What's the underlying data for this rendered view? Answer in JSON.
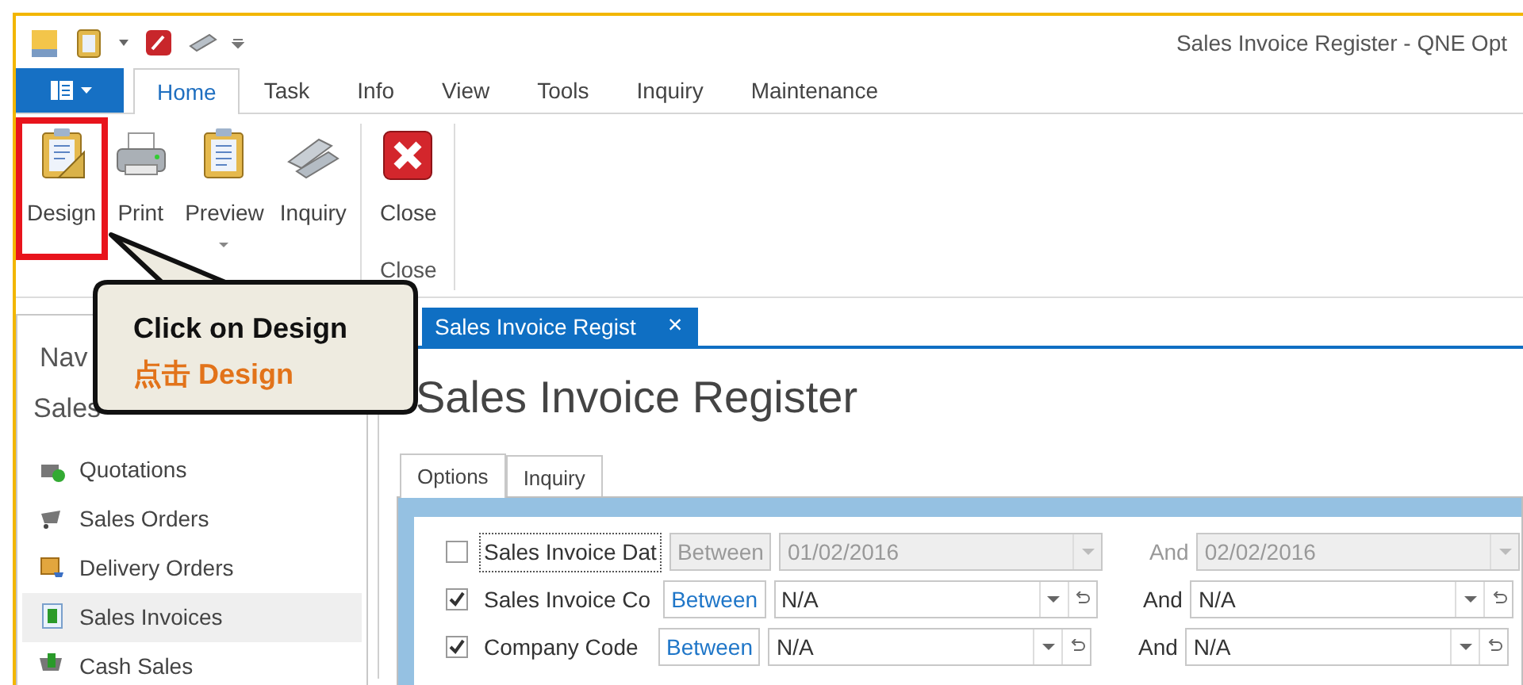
{
  "window": {
    "title": "Sales Invoice Register - QNE Opt"
  },
  "ribbon": {
    "tabs": [
      {
        "label": "Home",
        "selected": true
      },
      {
        "label": "Task",
        "selected": false
      },
      {
        "label": "Info",
        "selected": false
      },
      {
        "label": "View",
        "selected": false
      },
      {
        "label": "Tools",
        "selected": false
      },
      {
        "label": "Inquiry",
        "selected": false
      },
      {
        "label": "Maintenance",
        "selected": false
      }
    ],
    "groups": [
      {
        "buttons": [
          {
            "label": "Design",
            "highlighted": true,
            "dropdown": false
          },
          {
            "label": "Print",
            "highlighted": false,
            "dropdown": false
          },
          {
            "label": "Preview",
            "highlighted": false,
            "dropdown": true
          },
          {
            "label": "Inquiry",
            "highlighted": false,
            "dropdown": false
          }
        ]
      },
      {
        "label": "Close",
        "buttons": [
          {
            "label": "Close",
            "highlighted": false,
            "dropdown": false
          }
        ]
      }
    ]
  },
  "callout": {
    "text": "Click on Design",
    "translation": "点击 Design"
  },
  "navigation": {
    "title": "Nav",
    "section": "Sales",
    "items": [
      {
        "label": "Quotations",
        "selected": false
      },
      {
        "label": "Sales Orders",
        "selected": false
      },
      {
        "label": "Delivery Orders",
        "selected": false
      },
      {
        "label": "Sales Invoices",
        "selected": true
      },
      {
        "label": "Cash Sales",
        "selected": false
      }
    ]
  },
  "document_tab": {
    "label": "Sales Invoice Regist",
    "close": "×"
  },
  "page_title": "Sales Invoice Register",
  "option_tabs": [
    {
      "label": "Options",
      "selected": true
    },
    {
      "label": "Inquiry",
      "selected": false
    }
  ],
  "filters": [
    {
      "kind": "date",
      "checked": false,
      "focused": true,
      "label": "Sales Invoice Dat",
      "operator": "Between",
      "from": "01/02/2016",
      "and": "And",
      "to": "02/02/2016"
    },
    {
      "kind": "lookup",
      "checked": true,
      "focused": false,
      "label": "Sales Invoice Co",
      "operator": "Between",
      "from": "N/A",
      "and": "And",
      "to": "N/A"
    },
    {
      "kind": "lookup",
      "checked": true,
      "focused": false,
      "label": "Company Code",
      "operator": "Between",
      "from": "N/A",
      "and": "And",
      "to": "N/A"
    }
  ]
}
